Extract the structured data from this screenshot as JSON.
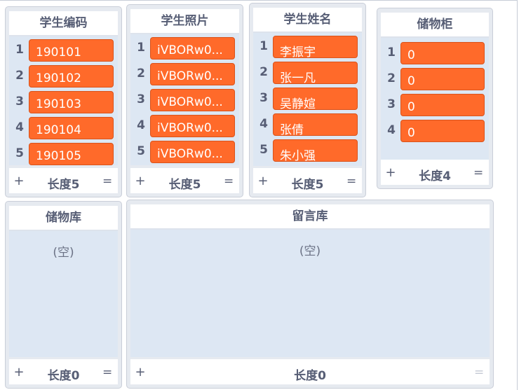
{
  "lists": {
    "student_id": {
      "title": "学生编码",
      "items": [
        {
          "index": "1",
          "value": "190101"
        },
        {
          "index": "2",
          "value": "190102"
        },
        {
          "index": "3",
          "value": "190103"
        },
        {
          "index": "4",
          "value": "190104"
        },
        {
          "index": "5",
          "value": "190105"
        }
      ],
      "add_label": "+",
      "length_label": "长度5",
      "resize_label": "="
    },
    "student_photo": {
      "title": "学生照片",
      "items": [
        {
          "index": "1",
          "value": "iVBORw0..."
        },
        {
          "index": "2",
          "value": "iVBORw0..."
        },
        {
          "index": "3",
          "value": "iVBORw0..."
        },
        {
          "index": "4",
          "value": "iVBORw0..."
        },
        {
          "index": "5",
          "value": "iVBORw0..."
        }
      ],
      "add_label": "+",
      "length_label": "长度5",
      "resize_label": "="
    },
    "student_name": {
      "title": "学生姓名",
      "items": [
        {
          "index": "1",
          "value": "李振宇"
        },
        {
          "index": "2",
          "value": "张一凡"
        },
        {
          "index": "3",
          "value": "吴静媗"
        },
        {
          "index": "4",
          "value": "张倩"
        },
        {
          "index": "5",
          "value": "朱小强"
        }
      ],
      "add_label": "+",
      "length_label": "长度5",
      "resize_label": "="
    },
    "locker": {
      "title": "储物柜",
      "items": [
        {
          "index": "1",
          "value": "0"
        },
        {
          "index": "2",
          "value": "0"
        },
        {
          "index": "3",
          "value": "0"
        },
        {
          "index": "4",
          "value": "0"
        }
      ],
      "add_label": "+",
      "length_label": "长度4",
      "resize_label": "="
    },
    "storage": {
      "title": "储物库",
      "empty_text": "(空)",
      "add_label": "+",
      "length_label": "长度0",
      "resize_label": "="
    },
    "message_store": {
      "title": "留言库",
      "empty_text": "(空)",
      "add_label": "+",
      "length_label": "长度0",
      "resize_label": "="
    }
  },
  "colors": {
    "item_fill": "#ff6a2a",
    "list_background": "#dde7f3",
    "label_text": "#575e75"
  }
}
